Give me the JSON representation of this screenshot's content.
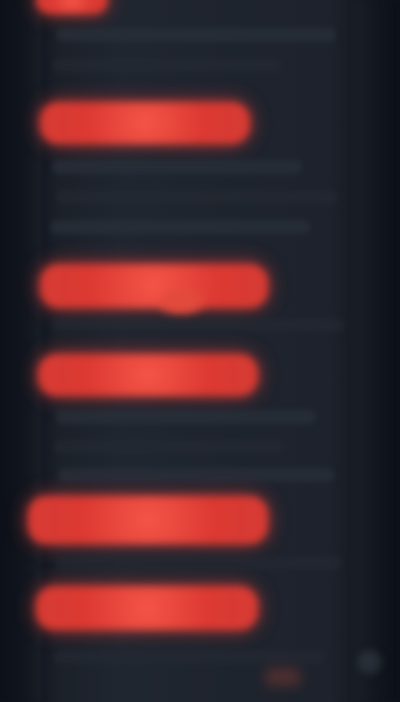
{
  "screen": {
    "accent_color": "#df3f36",
    "background_color": "#1d222c"
  },
  "highlighted_items": [
    {
      "label": ""
    },
    {
      "label": ""
    },
    {
      "label": ""
    },
    {
      "label": ""
    },
    {
      "label": ""
    },
    {
      "label": ""
    }
  ]
}
